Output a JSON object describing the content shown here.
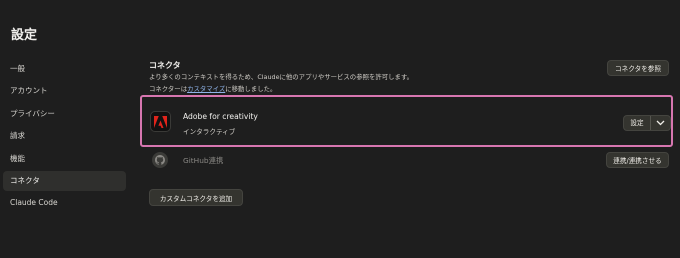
{
  "page": {
    "title": "設定"
  },
  "sidebar": {
    "items": [
      {
        "label": "一般",
        "active": false
      },
      {
        "label": "アカウント",
        "active": false
      },
      {
        "label": "プライバシー",
        "active": false
      },
      {
        "label": "請求",
        "active": false
      },
      {
        "label": "機能",
        "active": false
      },
      {
        "label": "コネクタ",
        "active": true
      },
      {
        "label": "Claude Code",
        "active": false
      }
    ]
  },
  "connectors": {
    "title": "コネクタ",
    "description_line1": "より多くのコンテキストを得るため、Claudeに他のアプリやサービスの参照を許可します。",
    "description_line2_prefix": "コネクターは",
    "description_line2_link": "カスタマイズ",
    "description_line2_suffix": "に移動しました。",
    "browse_button": "コネクタを参照",
    "items": [
      {
        "name": "Adobe for creativity",
        "subtitle": "インタラクティブ",
        "icon": "adobe-icon",
        "action_label": "設定",
        "highlighted": true
      },
      {
        "name": "GitHub連携",
        "icon": "github-icon",
        "action_label": "連携/連携させる"
      }
    ],
    "add_button": "カスタムコネクタを追加"
  },
  "colors": {
    "background": "#1e1e1e",
    "highlight_border": "#d776b0",
    "adobe_red": "#e0241b",
    "link": "#8fb3e8"
  }
}
